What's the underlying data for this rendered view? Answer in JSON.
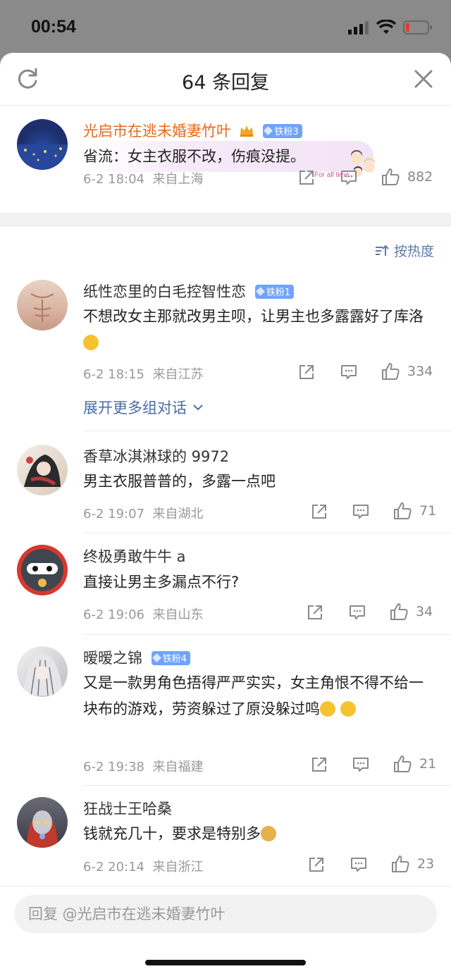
{
  "status_bar": {
    "time": "00:54"
  },
  "header": {
    "title": "64 条回复"
  },
  "main_comment": {
    "username": "光启市在逃未婚妻竹叶",
    "badge": "铁粉3",
    "text": "省流：女主衣服不改，伤痕没提。",
    "sticker_text": "For all time",
    "date": "6-2 18:04",
    "location": "来自上海",
    "likes": "882"
  },
  "sort": {
    "label": "按热度"
  },
  "comments": [
    {
      "username": "纸性恋里的白毛控智性恋",
      "badge": "铁粉1",
      "text": "不想改女主那就改男主呗，让男主也多露露好了库洛",
      "date": "6-2 18:15",
      "location": "来自江苏",
      "likes": "334"
    },
    {
      "username": "香草冰淇淋球的 9972",
      "badge": "",
      "text": "男主衣服普普的，多露一点吧",
      "date": "6-2 19:07",
      "location": "来自湖北",
      "likes": "71"
    },
    {
      "username": "终极勇敢牛牛 a",
      "badge": "",
      "text": "直接让男主多漏点不行?",
      "date": "6-2 19:06",
      "location": "来自山东",
      "likes": "34"
    },
    {
      "username": "暧暧之锦",
      "badge": "铁粉4",
      "text": "又是一款男角色捂得严严实实，女主角恨不得不给一块布的游戏，劳资躲过了原没躲过鸣",
      "date": "6-2 19:38",
      "location": "来自福建",
      "likes": "21"
    },
    {
      "username": "狂战士王哈桑",
      "badge": "",
      "text": "钱就充几十，要求是特别多",
      "date": "6-2 20:14",
      "location": "来自浙江",
      "likes": "23"
    }
  ],
  "expand_link": "展开更多组对话",
  "reply_bar": {
    "placeholder": "回复 @光启市在逃未婚妻竹叶"
  }
}
